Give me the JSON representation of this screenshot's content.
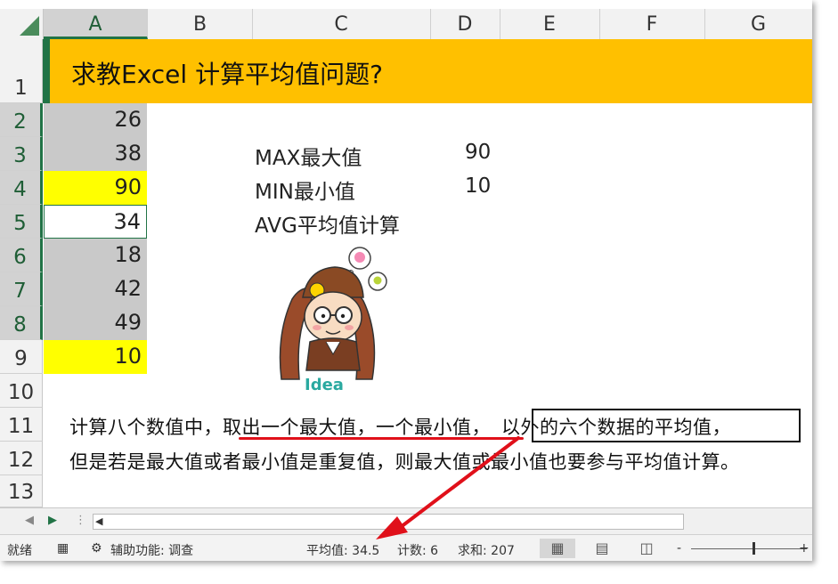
{
  "columns": [
    "A",
    "B",
    "C",
    "D",
    "E",
    "F",
    "G"
  ],
  "rows": [
    "1",
    "2",
    "3",
    "4",
    "5",
    "6",
    "7",
    "8",
    "9",
    "10",
    "11",
    "12",
    "13"
  ],
  "title": "求教Excel 计算平均值问题?",
  "values": [
    "26",
    "38",
    "90",
    "34",
    "18",
    "42",
    "49",
    "10"
  ],
  "labels": {
    "max_label": "MAX最大值",
    "max_value": "90",
    "min_label": "MIN最小值",
    "min_value": "10",
    "avg_label": "AVG平均值计算"
  },
  "note": {
    "line1_part1": "计算八个数值中，",
    "line1_part2": "取出一个最大值，一个最小值，",
    "line1_part3": "以外的六个数据的平均值，",
    "line2": "但是若是最大值或者最小值是重复值，则最大值或最小值也要参与平均值计算。"
  },
  "figure_text": "Idea",
  "statusbar": {
    "ready": "就绪",
    "accessibility": "辅助功能: 调查",
    "average": "平均值: 34.5",
    "count": "计数: 6",
    "sum": "求和: 207",
    "zoom_minus": "-",
    "zoom_plus": "+"
  },
  "colors": {
    "excel_green": "#217346",
    "banner": "#ffc000",
    "highlight_yellow": "#ffff00",
    "selection_gray": "#c9c9c9",
    "arrow_red": "#e0101a"
  }
}
